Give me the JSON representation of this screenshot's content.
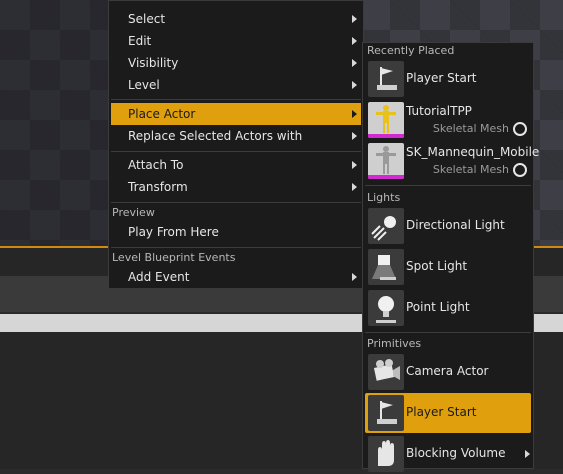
{
  "menu": {
    "items": [
      {
        "label": "Select"
      },
      {
        "label": "Edit"
      },
      {
        "label": "Visibility"
      },
      {
        "label": "Level"
      },
      {
        "label": "Place Actor"
      },
      {
        "label": "Replace Selected Actors with"
      },
      {
        "label": "Attach To"
      },
      {
        "label": "Transform"
      }
    ],
    "preview_header": "Preview",
    "play_from_here": "Play From Here",
    "blueprint_header": "Level Blueprint Events",
    "add_event": "Add Event"
  },
  "submenu": {
    "recently_placed_header": "Recently Placed",
    "recent": [
      {
        "label": "Player Start",
        "icon": "player-start-icon"
      },
      {
        "label": "TutorialTPP",
        "type": "Skeletal Mesh",
        "icon": "skeletal-mesh-thumbnail"
      },
      {
        "label": "SK_Mannequin_Mobile",
        "type": "Skeletal Mesh",
        "icon": "skeletal-mesh-thumbnail"
      }
    ],
    "lights_header": "Lights",
    "lights": [
      {
        "label": "Directional Light",
        "icon": "directional-light-icon"
      },
      {
        "label": "Spot Light",
        "icon": "spot-light-icon"
      },
      {
        "label": "Point Light",
        "icon": "point-light-icon"
      }
    ],
    "primitives_header": "Primitives",
    "primitives": [
      {
        "label": "Camera Actor",
        "icon": "camera-actor-icon"
      },
      {
        "label": "Player Start",
        "icon": "player-start-icon"
      },
      {
        "label": "Blocking Volume",
        "icon": "blocking-volume-icon"
      }
    ]
  },
  "colors": {
    "highlight": "#e0a00e",
    "menu_bg": "#1b1b1b",
    "skeletal_mesh_bar": "#d12ad1",
    "viewport_selection_edge": "#d08a12"
  }
}
